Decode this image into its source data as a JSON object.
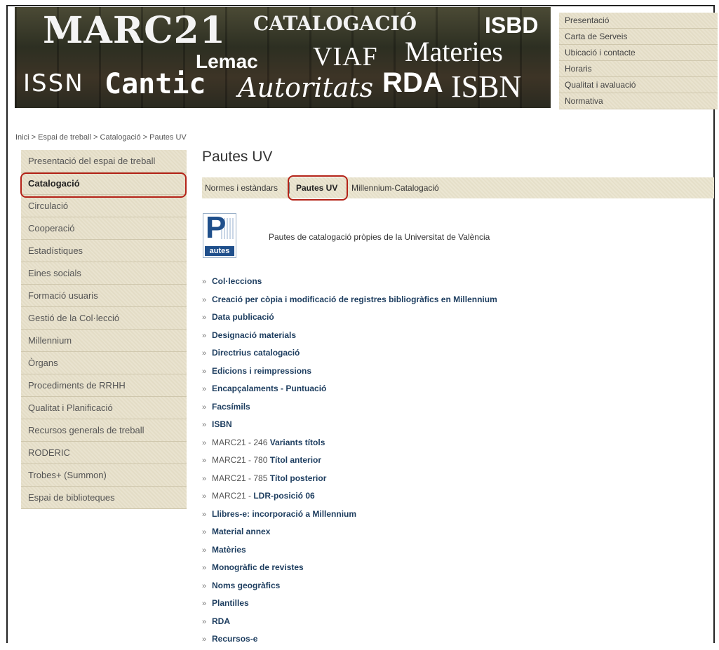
{
  "banner": {
    "words": [
      "MARC21",
      "CATALOGACIÓ",
      "ISBD",
      "Lemac",
      "VIAF",
      "Materies",
      "ISSN",
      "Cantic",
      "Autoritats",
      "RDA",
      "ISBN"
    ]
  },
  "top_menu": [
    "Presentació",
    "Carta de Serveis",
    "Ubicació i contacte",
    "Horaris",
    "Qualitat i avaluació",
    "Normativa"
  ],
  "breadcrumb": {
    "items": [
      "Inici",
      "Espai de treball",
      "Catalogació",
      "Pautes UV"
    ],
    "separator": ">"
  },
  "sidebar": {
    "items": [
      "Presentació del espai de treball",
      "Catalogació",
      "Circulació",
      "Cooperació",
      "Estadístiques",
      "Eines socials",
      "Formació usuaris",
      "Gestió de la Col·lecció",
      "Millennium",
      "Òrgans",
      "Procediments de RRHH",
      "Qualitat i Planificació",
      "Recursos generals de treball",
      "RODERIC",
      "Trobes+ (Summon)",
      "Espai de biblioteques"
    ],
    "active_index": 1
  },
  "main": {
    "title": "Pautes UV",
    "tabs": [
      "Normes i estàndars",
      "Pautes UV",
      "Millennium-Catalogació"
    ],
    "active_tab": 1,
    "logo": {
      "letter": "P",
      "word": "autes"
    },
    "intro": "Pautes de catalogació pròpies de la Universitat de València",
    "bullet": "»",
    "links": [
      {
        "prefix": "",
        "label": "Col·leccions"
      },
      {
        "prefix": "",
        "label": "Creació per còpia i modificació de registres bibliogràfics en Millennium"
      },
      {
        "prefix": "",
        "label": "Data publicació"
      },
      {
        "prefix": "",
        "label": "Designació materials"
      },
      {
        "prefix": "",
        "label": "Directrius catalogació"
      },
      {
        "prefix": "",
        "label": "Edicions i reimpressions"
      },
      {
        "prefix": "",
        "label": "Encapçalaments - Puntuació"
      },
      {
        "prefix": "",
        "label": "Facsímils"
      },
      {
        "prefix": "",
        "label": "ISBN"
      },
      {
        "prefix": "MARC21 - 246 ",
        "label": "Variants títols"
      },
      {
        "prefix": "MARC21 - 780 ",
        "label": "Títol anterior"
      },
      {
        "prefix": "MARC21 - 785 ",
        "label": "Títol posterior"
      },
      {
        "prefix": "MARC21 - ",
        "label": "LDR-posició 06"
      },
      {
        "prefix": "",
        "label": "Llibres-e: incorporació a Millennium"
      },
      {
        "prefix": "",
        "label": "Material annex"
      },
      {
        "prefix": "",
        "label": "Matèries"
      },
      {
        "prefix": "",
        "label": "Monogràfic de revistes"
      },
      {
        "prefix": "",
        "label": "Noms geogràfics"
      },
      {
        "prefix": "",
        "label": "Plantilles"
      },
      {
        "prefix": "",
        "label": "RDA"
      },
      {
        "prefix": "",
        "label": "Recursos-e"
      }
    ]
  },
  "colors": {
    "highlight": "#b42318",
    "link": "#1d3d5f",
    "panel": "#e7e1cb"
  }
}
